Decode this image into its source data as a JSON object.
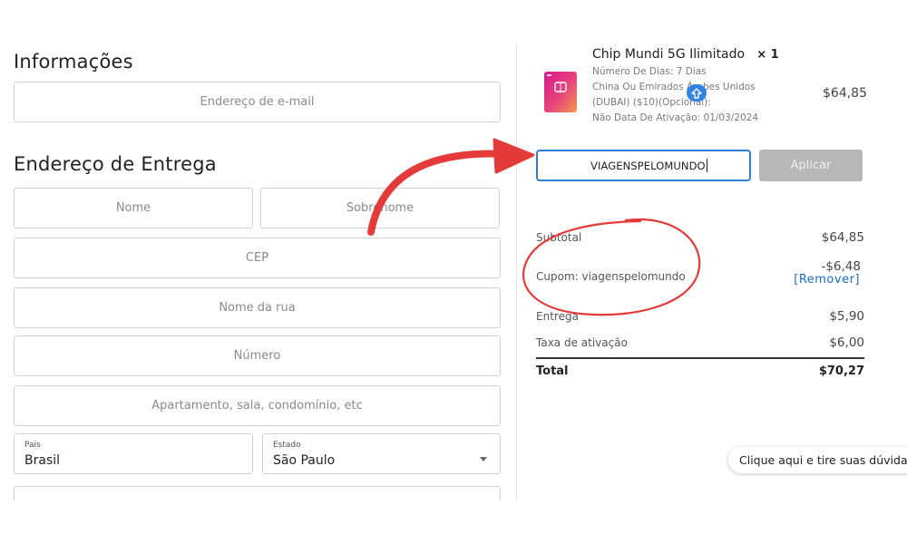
{
  "info": {
    "title": "Informações",
    "email_placeholder": "Endereço de e-mail"
  },
  "shipping": {
    "title": "Endereço de Entrega",
    "first_name_placeholder": "Nome",
    "last_name_placeholder": "Sobrenome",
    "zip_placeholder": "CEP",
    "street_placeholder": "Nome da rua",
    "number_placeholder": "Número",
    "complement_placeholder": "Apartamento, sala, condomínio, etc",
    "country_label": "País",
    "country_value": "Brasil",
    "state_label": "Estado",
    "state_value": "São Paulo"
  },
  "product": {
    "name": "Chip Mundi 5G Ilimitado",
    "qty": "× 1",
    "days": "Número De Dias:  7 Dias",
    "region_line1": "China Ou Emirados Árabes Unidos",
    "region_line2": "(DUBAI) ($10)(Opcional):",
    "activation": "Não  Data De Ativação:  01/03/2024",
    "price": "$64,85"
  },
  "coupon": {
    "value": "VIAGENSPELOMUNDO",
    "apply_label": "Aplicar"
  },
  "summary": {
    "subtotal_label": "Subtotal",
    "subtotal_value": "$64,85",
    "coupon_label": "Cupom: viagenspelomundo",
    "coupon_value": "-$6,48",
    "remove_label": "[Remover]",
    "shipping_label": "Entrega",
    "shipping_value": "$5,90",
    "activation_label": "Taxa de ativação",
    "activation_value": "$6,00",
    "total_label": "Total",
    "total_value": "$70,27"
  },
  "chat": {
    "label": "Clique aqui e tire suas dúvidas"
  },
  "colors": {
    "accent": "#2f7fd9",
    "annotation": "#e53a3a",
    "button_disabled": "#b7b7b7",
    "link": "#1a6fc4"
  }
}
